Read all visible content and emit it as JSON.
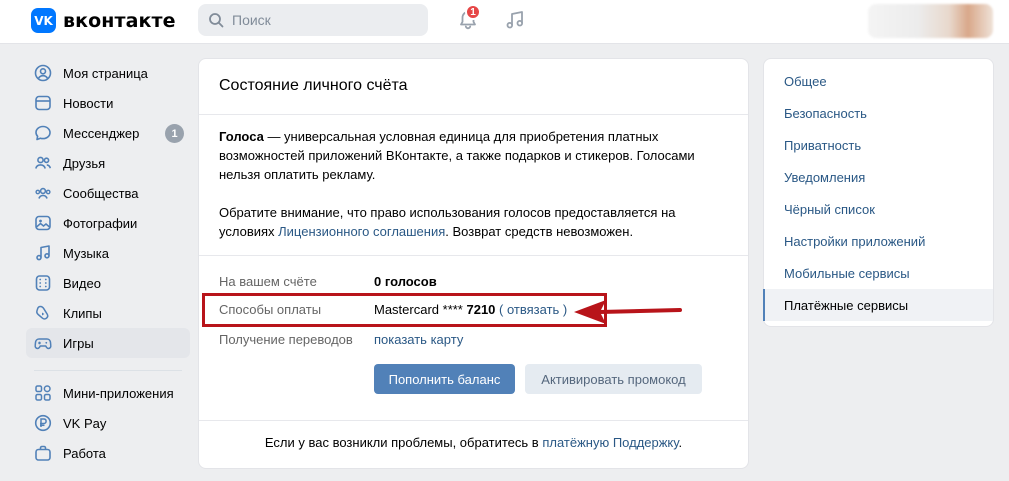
{
  "header": {
    "logo_mark": "VK",
    "logo_text": "вконтакте",
    "search_placeholder": "Поиск",
    "notifications_count": "1"
  },
  "leftnav": {
    "items": [
      {
        "label": "Моя страница",
        "icon": "user-icon"
      },
      {
        "label": "Новости",
        "icon": "news-icon"
      },
      {
        "label": "Мессенджер",
        "icon": "message-icon",
        "count": "1"
      },
      {
        "label": "Друзья",
        "icon": "friends-icon"
      },
      {
        "label": "Сообщества",
        "icon": "communities-icon"
      },
      {
        "label": "Фотографии",
        "icon": "photo-icon"
      },
      {
        "label": "Музыка",
        "icon": "music-icon"
      },
      {
        "label": "Видео",
        "icon": "video-icon"
      },
      {
        "label": "Клипы",
        "icon": "clips-icon"
      },
      {
        "label": "Игры",
        "icon": "gamepad-icon",
        "active": true
      }
    ],
    "items2": [
      {
        "label": "Мини-приложения",
        "icon": "apps-icon"
      },
      {
        "label": "VK Pay",
        "icon": "vkpay-icon"
      },
      {
        "label": "Работа",
        "icon": "briefcase-icon"
      }
    ]
  },
  "main": {
    "title": "Состояние личного счёта",
    "p1_bold": "Голоса",
    "p1_text": " — универсальная условная единица для приобретения платных возможностей приложений ВКонтакте, а также подарков и стикеров. Голосами нельзя оплатить рекламу.",
    "p2_before": "Обратите внимание, что право использования голосов предоставляется на условиях ",
    "p2_link": "Лицензионного соглашения",
    "p2_after": ". Возврат средств невозможен.",
    "balance_label": "На вашем счёте",
    "balance_value": "0 голосов",
    "payment_label": "Способы оплаты",
    "payment_card": "Mastercard **** ",
    "payment_digits": "7210",
    "payment_open": " ( ",
    "payment_unlink": "отвязать",
    "payment_close": " )",
    "transfers_label": "Получение переводов",
    "transfers_link": "показать карту",
    "btn_topup": "Пополнить баланс",
    "btn_promo": "Активировать промокод",
    "footer_before": "Если у вас возникли проблемы, обратитесь в ",
    "footer_link": "платёжную Поддержку",
    "footer_after": "."
  },
  "rightmenu": {
    "items": [
      "Общее",
      "Безопасность",
      "Приватность",
      "Уведомления",
      "Чёрный список",
      "Настройки приложений",
      "Мобильные сервисы",
      "Платёжные сервисы"
    ],
    "active_index": 7
  },
  "colors": {
    "accent": "#5181b8",
    "link": "#2a5885",
    "highlight": "#b8141a",
    "background": "#edeef0"
  }
}
